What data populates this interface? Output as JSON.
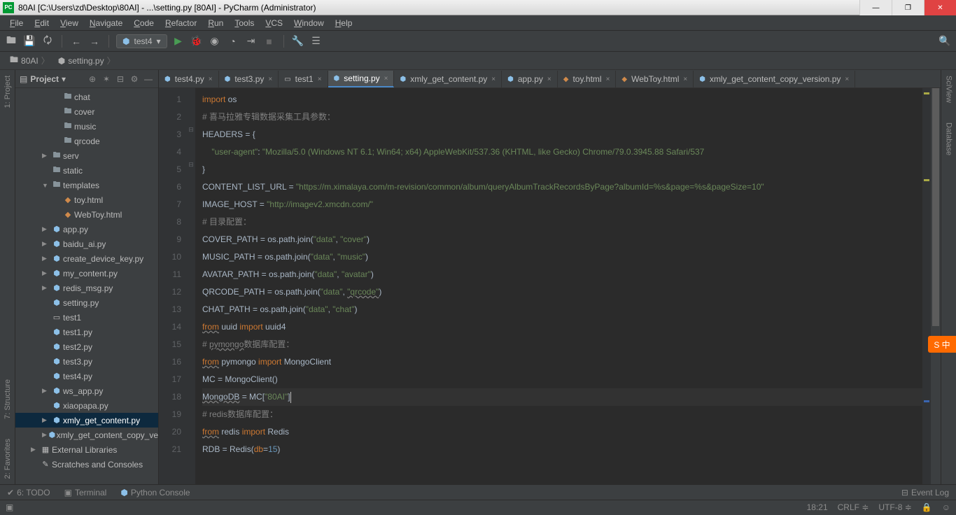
{
  "title": "80AI [C:\\Users\\zd\\Desktop\\80AI] - ...\\setting.py [80AI] - PyCharm (Administrator)",
  "titlebar_icon": "PC",
  "menu": [
    "File",
    "Edit",
    "View",
    "Navigate",
    "Code",
    "Refactor",
    "Run",
    "Tools",
    "VCS",
    "Window",
    "Help"
  ],
  "run_config": "test4",
  "breadcrumb": [
    {
      "icon": "folder",
      "label": "80AI"
    },
    {
      "icon": "py",
      "label": "setting.py"
    }
  ],
  "project_panel": {
    "title": "Project",
    "tree": [
      {
        "indent": 3,
        "arrow": "",
        "icon": "folder",
        "label": "chat"
      },
      {
        "indent": 3,
        "arrow": "",
        "icon": "folder",
        "label": "cover"
      },
      {
        "indent": 3,
        "arrow": "",
        "icon": "folder",
        "label": "music"
      },
      {
        "indent": 3,
        "arrow": "",
        "icon": "folder",
        "label": "qrcode"
      },
      {
        "indent": 2,
        "arrow": "▶",
        "icon": "folder",
        "label": "serv"
      },
      {
        "indent": 2,
        "arrow": "",
        "icon": "folder",
        "label": "static"
      },
      {
        "indent": 2,
        "arrow": "▼",
        "icon": "folder",
        "label": "templates"
      },
      {
        "indent": 3,
        "arrow": "",
        "icon": "html",
        "label": "toy.html"
      },
      {
        "indent": 3,
        "arrow": "",
        "icon": "html",
        "label": "WebToy.html"
      },
      {
        "indent": 2,
        "arrow": "▶",
        "icon": "py",
        "label": "app.py"
      },
      {
        "indent": 2,
        "arrow": "▶",
        "icon": "py",
        "label": "baidu_ai.py"
      },
      {
        "indent": 2,
        "arrow": "▶",
        "icon": "py",
        "label": "create_device_key.py"
      },
      {
        "indent": 2,
        "arrow": "▶",
        "icon": "py",
        "label": "my_content.py"
      },
      {
        "indent": 2,
        "arrow": "▶",
        "icon": "py",
        "label": "redis_msg.py"
      },
      {
        "indent": 2,
        "arrow": "",
        "icon": "py",
        "label": "setting.py"
      },
      {
        "indent": 2,
        "arrow": "",
        "icon": "file",
        "label": "test1"
      },
      {
        "indent": 2,
        "arrow": "",
        "icon": "py",
        "label": "test1.py"
      },
      {
        "indent": 2,
        "arrow": "",
        "icon": "py",
        "label": "test2.py"
      },
      {
        "indent": 2,
        "arrow": "",
        "icon": "py",
        "label": "test3.py"
      },
      {
        "indent": 2,
        "arrow": "",
        "icon": "py",
        "label": "test4.py"
      },
      {
        "indent": 2,
        "arrow": "▶",
        "icon": "py",
        "label": "ws_app.py"
      },
      {
        "indent": 2,
        "arrow": "",
        "icon": "py",
        "label": "xiaopapa.py"
      },
      {
        "indent": 2,
        "arrow": "▶",
        "icon": "py",
        "label": "xmly_get_content.py",
        "selected": true
      },
      {
        "indent": 2,
        "arrow": "▶",
        "icon": "py",
        "label": "xmly_get_content_copy_ve"
      },
      {
        "indent": 1,
        "arrow": "▶",
        "icon": "lib",
        "label": "External Libraries"
      },
      {
        "indent": 1,
        "arrow": "",
        "icon": "scratch",
        "label": "Scratches and Consoles"
      }
    ]
  },
  "tabs": [
    {
      "icon": "py",
      "label": "test4.py"
    },
    {
      "icon": "py",
      "label": "test3.py"
    },
    {
      "icon": "file",
      "label": "test1"
    },
    {
      "icon": "py",
      "label": "setting.py",
      "active": true
    },
    {
      "icon": "py",
      "label": "xmly_get_content.py"
    },
    {
      "icon": "py",
      "label": "app.py"
    },
    {
      "icon": "html",
      "label": "toy.html"
    },
    {
      "icon": "html",
      "label": "WebToy.html"
    },
    {
      "icon": "py",
      "label": "xmly_get_content_copy_version.py"
    }
  ],
  "gutter_lines": [
    "1",
    "2",
    "3",
    "4",
    "5",
    "6",
    "7",
    "8",
    "9",
    "10",
    "11",
    "12",
    "13",
    "14",
    "15",
    "16",
    "17",
    "18",
    "19",
    "20",
    "21"
  ],
  "left_labels": [
    "1: Project"
  ],
  "left_labels2": [
    "2: Favorites",
    "7: Structure"
  ],
  "right_labels": [
    "SciView",
    "Database"
  ],
  "bottom_tools": {
    "todo": "6: TODO",
    "terminal": "Terminal",
    "pyconsole": "Python Console",
    "eventlog": "Event Log"
  },
  "status": {
    "pos": "18:21",
    "lineend": "CRLF",
    "encoding": "UTF-8"
  },
  "ime_text": "S 中",
  "code_tokens": {
    "l1_import": "import",
    "l1_os": " os",
    "l2": "# 喜马拉雅专辑数据采集工具参数：",
    "l3": "HEADERS = {",
    "l4a": "    ",
    "l4b": "\"user-agent\"",
    "l4c": ": ",
    "l4d": "\"Mozilla/5.0 (Windows NT 6.1; Win64; x64) AppleWebKit/537.36 (KHTML, like Gecko) Chrome/79.0.3945.88 Safari/537",
    "l5": "}",
    "l6a": "CONTENT_LIST_URL = ",
    "l6b": "\"https://m.ximalaya.com/m-revision/common/album/queryAlbumTrackRecordsByPage?albumId=%s&page=%s&pageSize=10\"",
    "l7a": "IMAGE_HOST = ",
    "l7b": "\"http://imagev2.xmcdn.com/\"",
    "l8": "# 目录配置：",
    "l9a": "COVER_PATH = os.path.join(",
    "l9b": "\"data\"",
    "l9c": ", ",
    "l9d": "\"cover\"",
    "l9e": ")",
    "l10a": "MUSIC_PATH = os.path.join(",
    "l10b": "\"data\"",
    "l10c": ", ",
    "l10d": "\"music\"",
    "l10e": ")",
    "l11a": "AVATAR_PATH = os.path.join(",
    "l11b": "\"data\"",
    "l11c": ", ",
    "l11d": "\"avatar\"",
    "l11e": ")",
    "l12a": "QRCODE_PATH = os.path.join(",
    "l12b": "\"data\"",
    "l12c": ", ",
    "l12d": "\"qrcode\"",
    "l12e": ")",
    "l13a": "CHAT_PATH = os.path.join(",
    "l13b": "\"data\"",
    "l13c": ", ",
    "l13d": "\"chat\"",
    "l13e": ")",
    "l14a": "from",
    "l14b": " uuid ",
    "l14c": "import",
    "l14d": " uuid4",
    "l15a": "# ",
    "l15b": "pymongo",
    "l15c": "数据库配置：",
    "l16a": "from",
    "l16b": " pymongo ",
    "l16c": "import",
    "l16d": " MongoClient",
    "l17": "MC = MongoClient()",
    "l18a": "MongoDB = MC[",
    "l18b": "\"80AI\"",
    "l18c": "]",
    "l19": "# redis数据库配置：",
    "l20a": "from",
    "l20b": " redis ",
    "l20c": "import",
    "l20d": " Redis",
    "l21a": "RDB = Redis(",
    "l21b": "db",
    "l21c": "=",
    "l21d": "15",
    "l21e": ")"
  }
}
